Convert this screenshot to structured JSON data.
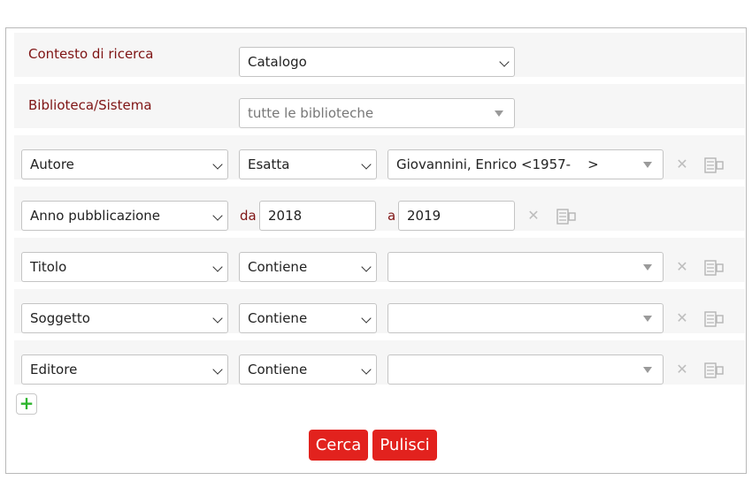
{
  "form": {
    "context": {
      "label": "Contesto di ricerca",
      "value": "Catalogo"
    },
    "library": {
      "label": "Biblioteca/Sistema",
      "value": "tutte le biblioteche"
    },
    "rows": [
      {
        "field": "Autore",
        "operator": "Esatta",
        "value": "Giovannini, Enrico <1957-    >"
      },
      {
        "field": "Anno pubblicazione",
        "from_label": "da",
        "from_value": "2018",
        "to_label": "a",
        "to_value": "2019"
      },
      {
        "field": "Titolo",
        "operator": "Contiene",
        "value": ""
      },
      {
        "field": "Soggetto",
        "operator": "Contiene",
        "value": ""
      },
      {
        "field": "Editore",
        "operator": "Contiene",
        "value": ""
      }
    ],
    "row_actions": {
      "remove_icon": "close-icon",
      "builder_icon": "term-builder-icon"
    },
    "add_row": {
      "icon": "plus-icon",
      "symbol": "+"
    },
    "buttons": {
      "search": "Cerca",
      "clear": "Pulisci"
    }
  },
  "colors": {
    "label_text": "#7f1414",
    "button_bg": "#e2221e",
    "add_icon": "#2db52d",
    "row_bg": "#f6f6f6"
  }
}
